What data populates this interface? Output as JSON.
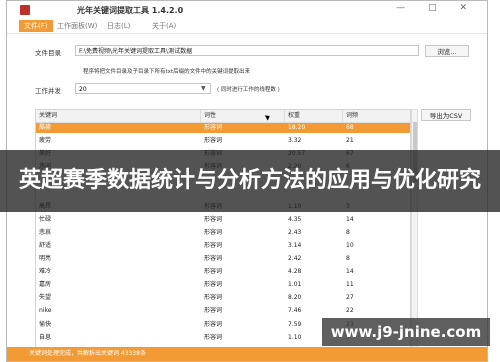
{
  "window": {
    "title": "光年关键词提取工具 1.4.2.0",
    "controls": "— □ ✕"
  },
  "menu": [
    "文件(F)",
    "工作面板(W)",
    "日志(L)",
    "关于(A)"
  ],
  "form": {
    "dir_label": "文件目录",
    "dir_value": "F:\\免费视频\\光年关键词提取工具\\测试数据",
    "browse_label": "浏览...",
    "hint": "程序将把文件目录及子目录下所有txt后缀的文件中的关键词提取出来",
    "concurrency_label": "工作并发",
    "concurrency_value": "20",
    "thread_hint": "( 同时进行工作的线程数 )"
  },
  "table": {
    "headers": [
      "关键词",
      "词性",
      "权重",
      "词频"
    ],
    "rows": [
      [
        "酷毙",
        "形容词",
        "18.20",
        "68"
      ],
      [
        "疲劳",
        "形容词",
        "3.32",
        "21"
      ],
      [
        "美好",
        "形容词",
        "20.57",
        "67"
      ],
      [
        "悠闲",
        "形容词",
        "2.20",
        "6"
      ],
      [
        "",
        "",
        "",
        ""
      ],
      [
        "",
        "",
        "",
        ""
      ],
      [
        "高昂",
        "形容词",
        "1.10",
        "3"
      ],
      [
        "忙碌",
        "形容词",
        "4.35",
        "14"
      ],
      [
        "悲哀",
        "形容词",
        "2.43",
        "8"
      ],
      [
        "舒适",
        "形容词",
        "3.14",
        "10"
      ],
      [
        "明亮",
        "形容词",
        "2.42",
        "8"
      ],
      [
        "难冷",
        "形容词",
        "4.28",
        "14"
      ],
      [
        "嘉房",
        "形容词",
        "1.01",
        "11"
      ],
      [
        "失望",
        "形容词",
        "8.20",
        "27"
      ],
      [
        "nike",
        "形容词",
        "7.46",
        "22"
      ],
      [
        "愉快",
        "形容词",
        "7.59",
        "23"
      ],
      [
        "自息",
        "形容词",
        "1.10",
        "3"
      ]
    ]
  },
  "export_label": "导出为CSV",
  "status": "关键词处理完成，共解析出关键词 43338条",
  "banner": "英超赛季数据统计与分析方法的应用与优化研究",
  "watermark": "www.j9-jnine.com",
  "colors": {
    "accent": "#f29a34"
  }
}
